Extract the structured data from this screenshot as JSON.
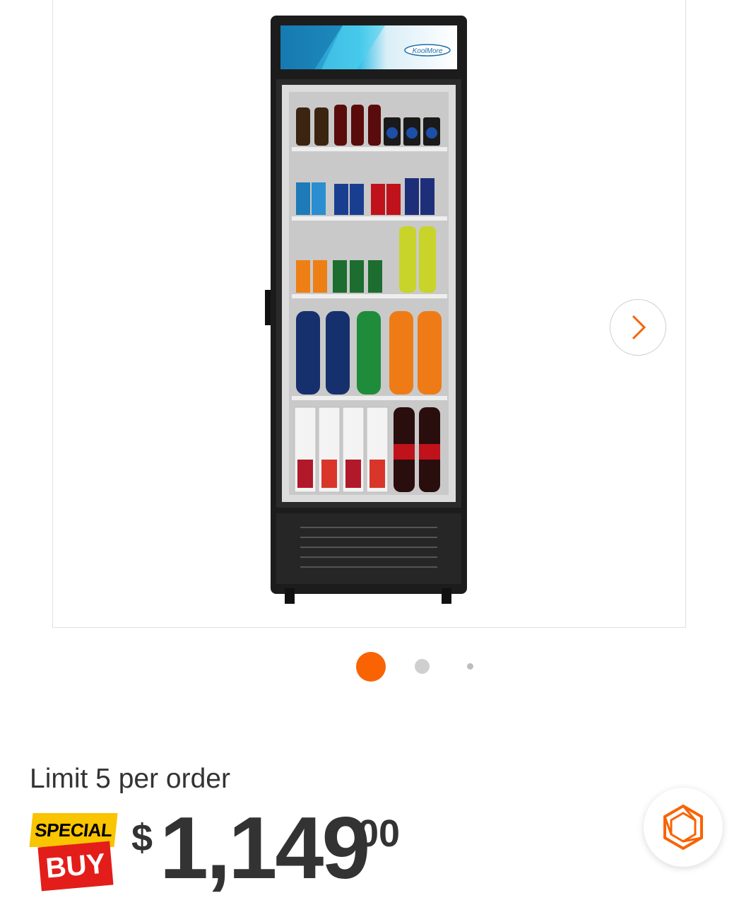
{
  "gallery": {
    "image_alt": "Glass door merchandiser refrigerator",
    "brand_logo": "KoolMore",
    "next_icon": "chevron-right-icon",
    "current_slide": 1,
    "slide_count": 3
  },
  "product": {
    "limit_text": "Limit 5 per order",
    "badge": {
      "top": "SPECIAL",
      "bottom": "BUY"
    },
    "price": {
      "symbol": "$",
      "dollars": "1,149",
      "cents": "00"
    }
  },
  "chat": {
    "icon": "hexagon-chat-icon"
  },
  "colors": {
    "accent": "#f96302",
    "badge_yellow": "#f9c400",
    "badge_red": "#e31d1a",
    "text": "#333333"
  }
}
